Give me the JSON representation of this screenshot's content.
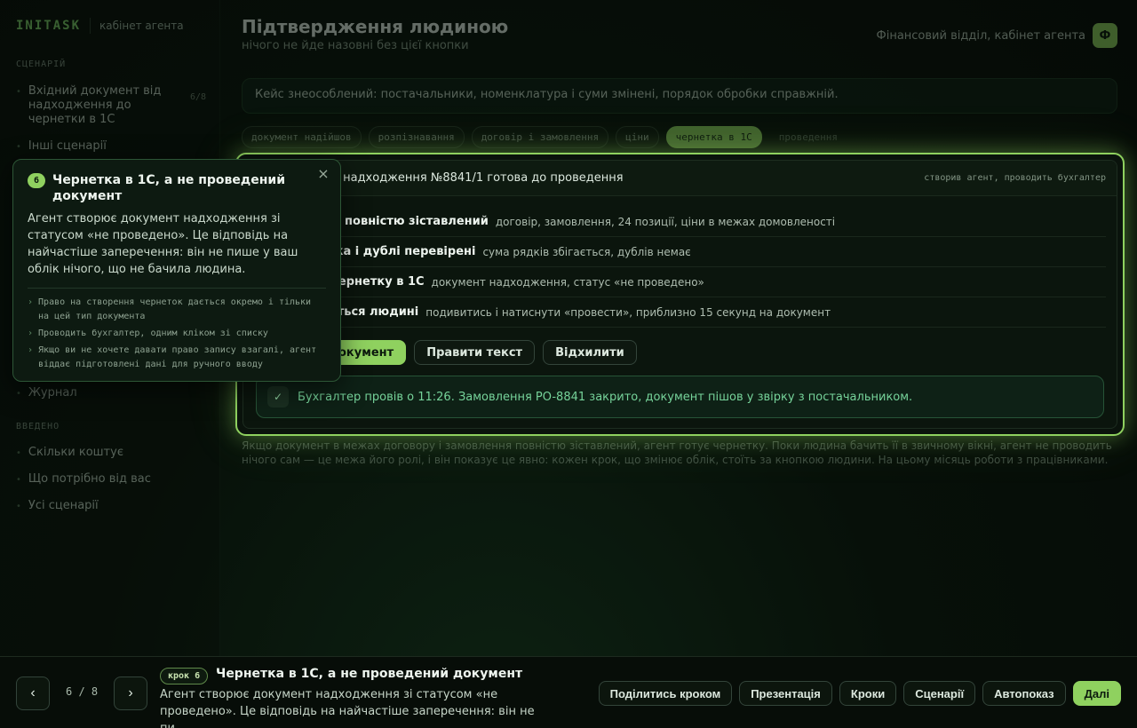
{
  "brand": {
    "logo": "INITASK",
    "subtitle": "кабінет агента"
  },
  "sidebar": {
    "section_scenario": "СЦЕНАРІЙ",
    "scenario_items": [
      {
        "label": "Вхідний документ від надходження до чернетки в 1С",
        "count": "6/8"
      },
      {
        "label": "Інші сценарії"
      }
    ],
    "journal_label": "Журнал",
    "section_intro": "ВВЕДЕНО",
    "intro_items": [
      {
        "label": "Скільки коштує"
      },
      {
        "label": "Що потрібно від вас"
      },
      {
        "label": "Усі сценарії"
      }
    ]
  },
  "header": {
    "title": "Підтвердження людиною",
    "subtitle": "нічого не йде назовні без цієї кнопки",
    "context": "Фінансовий відділ, кабінет агента",
    "avatar": "Ф"
  },
  "banner": "Кейс знеособлений: постачальники, номенклатура і суми змінені, порядок обробки справжній.",
  "steps": [
    {
      "label": "документ надійшов",
      "state": "done"
    },
    {
      "label": "розпізнавання",
      "state": "done"
    },
    {
      "label": "договір і замовлення",
      "state": "done"
    },
    {
      "label": "ціни",
      "state": "done"
    },
    {
      "label": "чернетка в 1С",
      "state": "active"
    },
    {
      "label": "проведення",
      "state": "muted"
    }
  ],
  "card": {
    "title": "Чернетка надходження №8841/1 готова до проведення",
    "title_visible": "а надходження №8841/1 готова до проведення",
    "meta": "створив агент, проводить бухгалтер",
    "rows": [
      {
        "label": "т повністю зіставлений",
        "desc": "договір, замовлення, 24 позиції, ціни в межах домовленості"
      },
      {
        "label": "мка і дублі перевірені",
        "desc": "сума рядків збігається, дублів немає"
      },
      {
        "label": "чернетку в 1С",
        "desc": "документ надходження, статус «не проведено»"
      },
      {
        "label": "ється людині",
        "desc": "подивитись і натиснути «провести», приблизно 15 секунд на документ"
      }
    ],
    "actions": {
      "primary": "окумент",
      "edit": "Правити текст",
      "reject": "Відхилити"
    },
    "success": "Бухгалтер провів о 11:26. Замовлення PO-8841 закрито, документ пішов у звірку з постачальником."
  },
  "after_text": "Якщо документ в межах договору і замовлення повністю зіставлений, агент готує чернетку. Поки людина бачить її в звичному вікні, агент не проводить нічого сам — це межа його ролі, і він показує це явно: кожен крок, що змінює облік, стоїть за кнопкою людини. На цьому місяць роботи з працівниками.",
  "tooltip": {
    "number": "6",
    "title": "Чернетка в 1С, а не проведений документ",
    "close": "×",
    "body": "Агент створює документ надходження зі статусом «не проведено». Це відповідь на найчастіше заперечення: він не пише у ваш облік нічого, що не бачила людина.",
    "bullets": [
      "Право на створення чернеток дається окремо і тільки на цей тип документа",
      "Проводить бухгалтер, одним кліком зі списку",
      "Якщо ви не хочете давати право запису взагалі, агент віддає підготовлені дані для ручного вводу"
    ]
  },
  "bottombar": {
    "prev": "‹",
    "next": "›",
    "pager": "6 / 8",
    "step_tag": "крок 6",
    "title": "Чернетка в 1С, а не проведений документ",
    "desc": "Агент створює документ надходження зі статусом «не проведено». Це відповідь на найчастіше заперечення: він не пи…",
    "buttons": {
      "share": "Поділитись кроком",
      "present": "Презентація",
      "steps": "Кроки",
      "scenarios": "Сценарії",
      "autoplay": "Автопоказ",
      "next": "Далі"
    }
  },
  "colors": {
    "accent": "#8fd15f",
    "success": "#76d39a",
    "background": "#050a06"
  }
}
